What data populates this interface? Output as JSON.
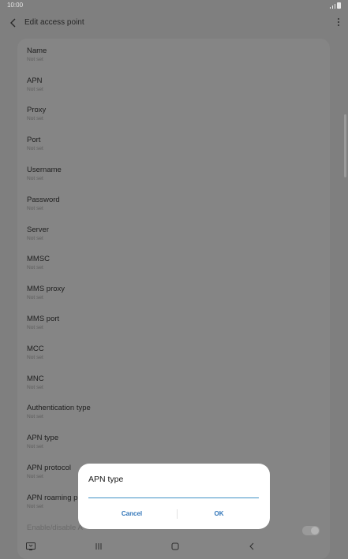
{
  "status_bar": {
    "time": "10:00"
  },
  "app_bar": {
    "title": "Edit access point",
    "back_icon": "back-arrow-icon",
    "more_icon": "more-vertical-icon"
  },
  "settings": {
    "items": [
      {
        "label": "Name",
        "value": "Not set"
      },
      {
        "label": "APN",
        "value": "Not set"
      },
      {
        "label": "Proxy",
        "value": "Not set"
      },
      {
        "label": "Port",
        "value": "Not set"
      },
      {
        "label": "Username",
        "value": "Not set"
      },
      {
        "label": "Password",
        "value": "Not set"
      },
      {
        "label": "Server",
        "value": "Not set"
      },
      {
        "label": "MMSC",
        "value": "Not set"
      },
      {
        "label": "MMS proxy",
        "value": "Not set"
      },
      {
        "label": "MMS port",
        "value": "Not set"
      },
      {
        "label": "MCC",
        "value": "Not set"
      },
      {
        "label": "MNC",
        "value": "Not set"
      },
      {
        "label": "Authentication type",
        "value": "Not set"
      },
      {
        "label": "APN type",
        "value": "Not set"
      },
      {
        "label": "APN protocol",
        "value": "Not set"
      },
      {
        "label": "APN roaming p",
        "value": "Not set"
      },
      {
        "label": "Enable/disable A",
        "value": ""
      }
    ]
  },
  "dialog": {
    "title": "APN type",
    "input_value": "",
    "cancel_label": "Cancel",
    "ok_label": "OK",
    "accent_color": "#2f74b8"
  },
  "nav_bar": {
    "icons": [
      "keyboard-icon",
      "recents-icon",
      "home-icon",
      "back-icon"
    ]
  }
}
